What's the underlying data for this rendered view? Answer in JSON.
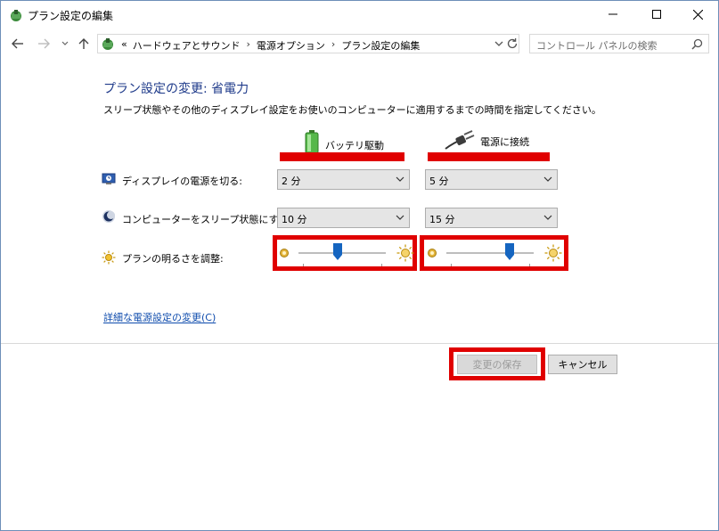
{
  "window": {
    "title": "プラン設定の編集"
  },
  "titlebar_buttons": {
    "minimize_icon": "minimize-icon",
    "maximize_icon": "maximize-icon",
    "close_icon": "close-icon"
  },
  "address": {
    "overflow": "«",
    "crumbs": [
      "ハードウェアとサウンド",
      "電源オプション",
      "プラン設定の編集"
    ],
    "separator": "›"
  },
  "search": {
    "placeholder": "コントロール パネルの検索"
  },
  "page": {
    "heading": "プラン設定の変更: 省電力",
    "description": "スリープ状態やその他のディスプレイ設定をお使いのコンピューターに適用するまでの時間を指定してください。"
  },
  "columns": {
    "battery": "バッテリ駆動",
    "plugged": "電源に接続"
  },
  "rows": {
    "display_off": {
      "label": "ディスプレイの電源を切る:",
      "battery": "2 分",
      "plugged": "5 分"
    },
    "sleep": {
      "label": "コンピューターをスリープ状態にする:",
      "battery": "10 分",
      "plugged": "15 分"
    },
    "brightness": {
      "label": "プランの明るさを調整:",
      "battery_level": 0.45,
      "plugged_level": 0.72
    }
  },
  "advanced_link": "詳細な電源設定の変更(C)",
  "buttons": {
    "save": "変更の保存",
    "cancel": "キャンセル"
  },
  "colors": {
    "highlight_red": "#e00000",
    "heading_blue": "#1e3a8a",
    "link_blue": "#0f4cad",
    "thumb_blue": "#1565c0"
  }
}
